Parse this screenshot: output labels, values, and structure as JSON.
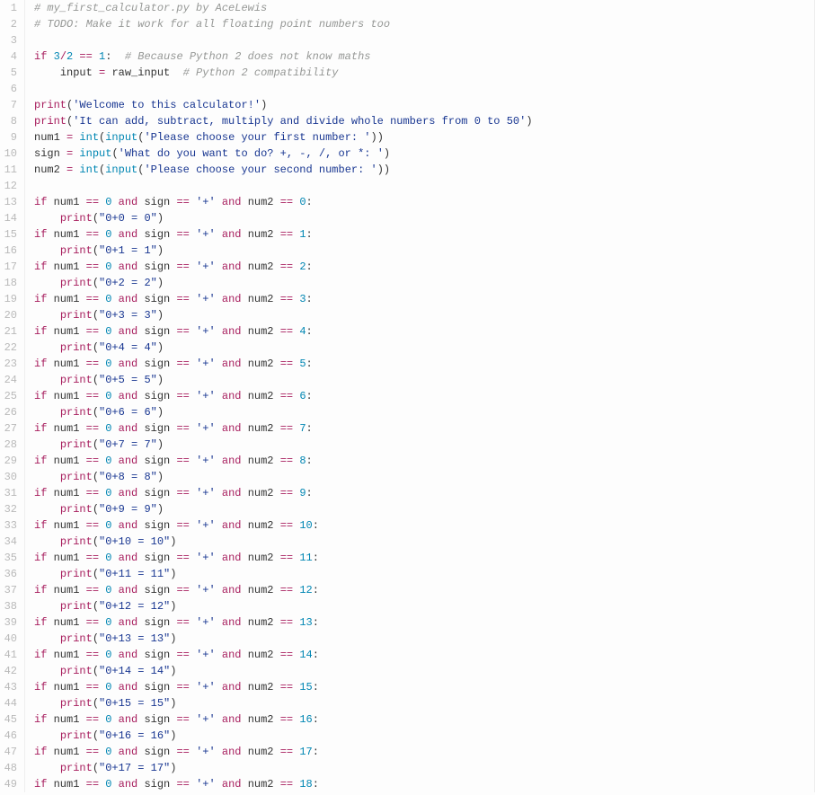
{
  "lines": [
    {
      "n": 1,
      "indent": 0,
      "tokens": [
        {
          "t": "# my_first_calculator.py by AceLewis",
          "c": "c-comment"
        }
      ]
    },
    {
      "n": 2,
      "indent": 0,
      "tokens": [
        {
          "t": "# TODO: Make it work for all floating point numbers too",
          "c": "c-comment"
        }
      ]
    },
    {
      "n": 3,
      "indent": 0,
      "tokens": []
    },
    {
      "n": 4,
      "indent": 0,
      "tokens": [
        {
          "t": "if",
          "c": "c-kw"
        },
        {
          "t": " "
        },
        {
          "t": "3",
          "c": "c-num"
        },
        {
          "t": "/",
          "c": "c-op"
        },
        {
          "t": "2",
          "c": "c-num"
        },
        {
          "t": " "
        },
        {
          "t": "==",
          "c": "c-op"
        },
        {
          "t": " "
        },
        {
          "t": "1",
          "c": "c-num"
        },
        {
          "t": ":  "
        },
        {
          "t": "# Because Python 2 does not know maths",
          "c": "c-comment"
        }
      ]
    },
    {
      "n": 5,
      "indent": 1,
      "tokens": [
        {
          "t": "input",
          "c": "c-ident"
        },
        {
          "t": " "
        },
        {
          "t": "=",
          "c": "c-op"
        },
        {
          "t": " "
        },
        {
          "t": "raw_input",
          "c": "c-ident"
        },
        {
          "t": "  "
        },
        {
          "t": "# Python 2 compatibility",
          "c": "c-comment"
        }
      ]
    },
    {
      "n": 6,
      "indent": 0,
      "tokens": []
    },
    {
      "n": 7,
      "indent": 0,
      "tokens": [
        {
          "t": "print",
          "c": "c-kw"
        },
        {
          "t": "("
        },
        {
          "t": "'Welcome to this calculator!'",
          "c": "c-str"
        },
        {
          "t": ")"
        }
      ]
    },
    {
      "n": 8,
      "indent": 0,
      "tokens": [
        {
          "t": "print",
          "c": "c-kw"
        },
        {
          "t": "("
        },
        {
          "t": "'It can add, subtract, multiply and divide whole numbers from 0 to 50'",
          "c": "c-str"
        },
        {
          "t": ")"
        }
      ]
    },
    {
      "n": 9,
      "indent": 0,
      "tokens": [
        {
          "t": "num1",
          "c": "c-ident"
        },
        {
          "t": " "
        },
        {
          "t": "=",
          "c": "c-op"
        },
        {
          "t": " "
        },
        {
          "t": "int",
          "c": "c-builtin"
        },
        {
          "t": "("
        },
        {
          "t": "input",
          "c": "c-builtin"
        },
        {
          "t": "("
        },
        {
          "t": "'Please choose your first number: '",
          "c": "c-str"
        },
        {
          "t": "))"
        }
      ]
    },
    {
      "n": 10,
      "indent": 0,
      "tokens": [
        {
          "t": "sign",
          "c": "c-ident"
        },
        {
          "t": " "
        },
        {
          "t": "=",
          "c": "c-op"
        },
        {
          "t": " "
        },
        {
          "t": "input",
          "c": "c-builtin"
        },
        {
          "t": "("
        },
        {
          "t": "'What do you want to do? +, -, /, or *: '",
          "c": "c-str"
        },
        {
          "t": ")"
        }
      ]
    },
    {
      "n": 11,
      "indent": 0,
      "tokens": [
        {
          "t": "num2",
          "c": "c-ident"
        },
        {
          "t": " "
        },
        {
          "t": "=",
          "c": "c-op"
        },
        {
          "t": " "
        },
        {
          "t": "int",
          "c": "c-builtin"
        },
        {
          "t": "("
        },
        {
          "t": "input",
          "c": "c-builtin"
        },
        {
          "t": "("
        },
        {
          "t": "'Please choose your second number: '",
          "c": "c-str"
        },
        {
          "t": "))"
        }
      ]
    },
    {
      "n": 12,
      "indent": 0,
      "tokens": []
    },
    {
      "n": 13,
      "kind": "ifline",
      "num2": 0
    },
    {
      "n": 14,
      "kind": "printline",
      "tail": "0+0 = 0"
    },
    {
      "n": 15,
      "kind": "ifline",
      "num2": 1
    },
    {
      "n": 16,
      "kind": "printline",
      "tail": "0+1 = 1"
    },
    {
      "n": 17,
      "kind": "ifline",
      "num2": 2
    },
    {
      "n": 18,
      "kind": "printline",
      "tail": "0+2 = 2"
    },
    {
      "n": 19,
      "kind": "ifline",
      "num2": 3
    },
    {
      "n": 20,
      "kind": "printline",
      "tail": "0+3 = 3"
    },
    {
      "n": 21,
      "kind": "ifline",
      "num2": 4
    },
    {
      "n": 22,
      "kind": "printline",
      "tail": "0+4 = 4"
    },
    {
      "n": 23,
      "kind": "ifline",
      "num2": 5
    },
    {
      "n": 24,
      "kind": "printline",
      "tail": "0+5 = 5"
    },
    {
      "n": 25,
      "kind": "ifline",
      "num2": 6
    },
    {
      "n": 26,
      "kind": "printline",
      "tail": "0+6 = 6"
    },
    {
      "n": 27,
      "kind": "ifline",
      "num2": 7
    },
    {
      "n": 28,
      "kind": "printline",
      "tail": "0+7 = 7"
    },
    {
      "n": 29,
      "kind": "ifline",
      "num2": 8
    },
    {
      "n": 30,
      "kind": "printline",
      "tail": "0+8 = 8"
    },
    {
      "n": 31,
      "kind": "ifline",
      "num2": 9
    },
    {
      "n": 32,
      "kind": "printline",
      "tail": "0+9 = 9"
    },
    {
      "n": 33,
      "kind": "ifline",
      "num2": 10
    },
    {
      "n": 34,
      "kind": "printline",
      "tail": "0+10 = 10"
    },
    {
      "n": 35,
      "kind": "ifline",
      "num2": 11
    },
    {
      "n": 36,
      "kind": "printline",
      "tail": "0+11 = 11"
    },
    {
      "n": 37,
      "kind": "ifline",
      "num2": 12
    },
    {
      "n": 38,
      "kind": "printline",
      "tail": "0+12 = 12"
    },
    {
      "n": 39,
      "kind": "ifline",
      "num2": 13
    },
    {
      "n": 40,
      "kind": "printline",
      "tail": "0+13 = 13"
    },
    {
      "n": 41,
      "kind": "ifline",
      "num2": 14
    },
    {
      "n": 42,
      "kind": "printline",
      "tail": "0+14 = 14"
    },
    {
      "n": 43,
      "kind": "ifline",
      "num2": 15
    },
    {
      "n": 44,
      "kind": "printline",
      "tail": "0+15 = 15"
    },
    {
      "n": 45,
      "kind": "ifline",
      "num2": 16
    },
    {
      "n": 46,
      "kind": "printline",
      "tail": "0+16 = 16"
    },
    {
      "n": 47,
      "kind": "ifline",
      "num2": 17
    },
    {
      "n": 48,
      "kind": "printline",
      "tail": "0+17 = 17"
    },
    {
      "n": 49,
      "kind": "ifline",
      "num2": 18
    }
  ],
  "ifTemplate": {
    "num1": 0,
    "sign": "'+'"
  }
}
